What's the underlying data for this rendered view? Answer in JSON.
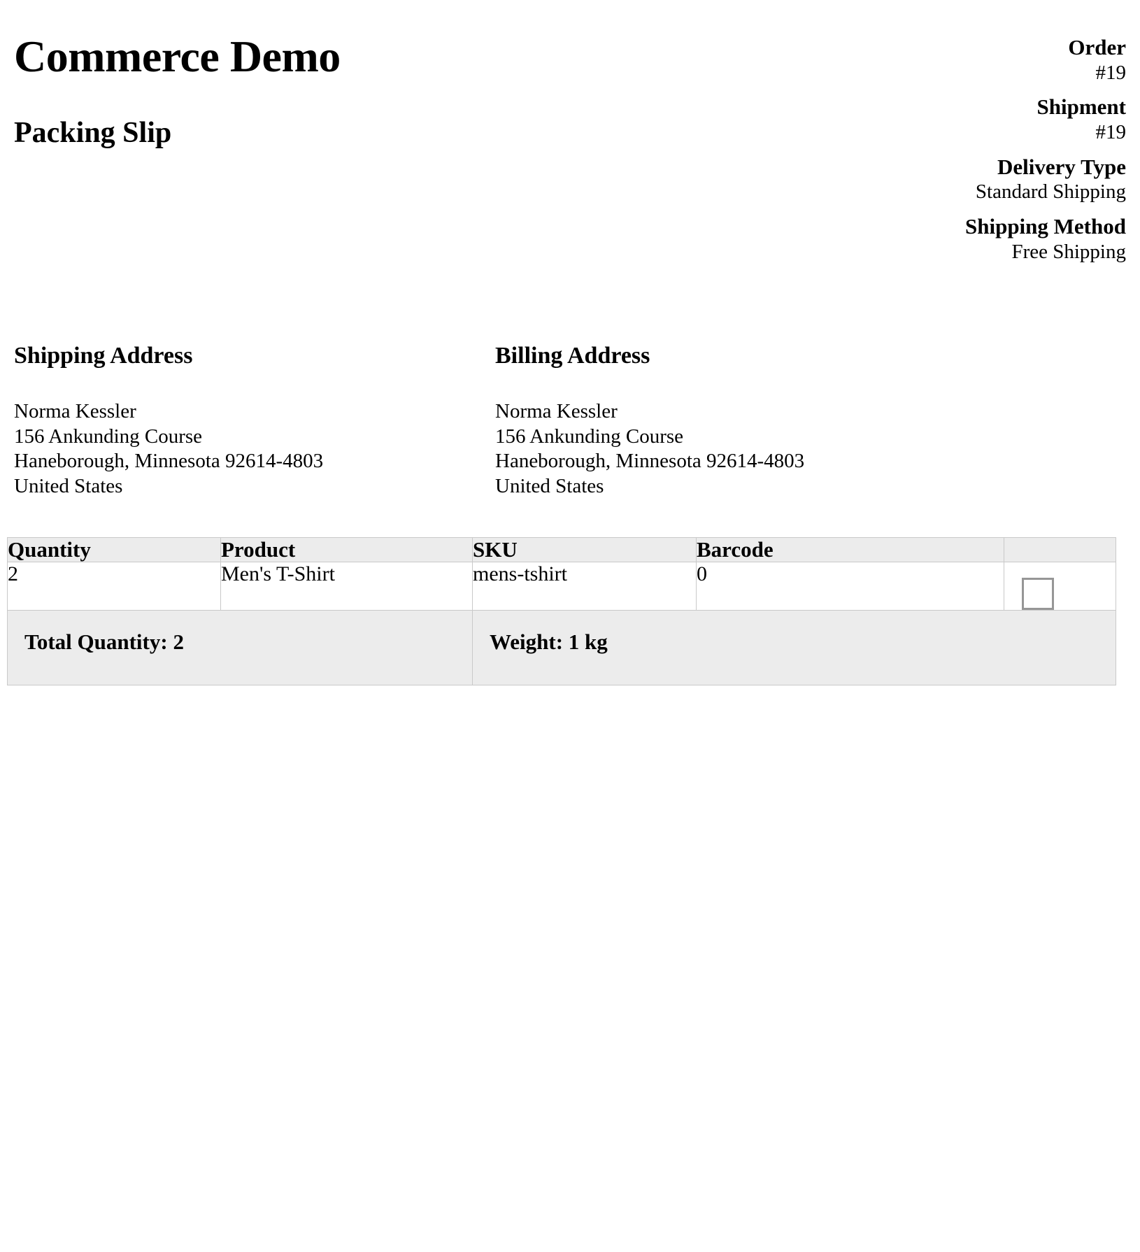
{
  "header": {
    "brand": "Commerce Demo",
    "document_title": "Packing Slip"
  },
  "meta": [
    {
      "label": "Order",
      "value": "#19"
    },
    {
      "label": "Shipment",
      "value": "#19"
    },
    {
      "label": "Delivery Type",
      "value": "Standard Shipping"
    },
    {
      "label": "Shipping Method",
      "value": "Free Shipping"
    }
  ],
  "shipping_address": {
    "heading": "Shipping Address",
    "lines": [
      "Norma Kessler",
      "156 Ankunding Course",
      "Haneborough, Minnesota 92614-4803",
      "United States"
    ]
  },
  "billing_address": {
    "heading": "Billing Address",
    "lines": [
      "Norma Kessler",
      "156 Ankunding Course",
      "Haneborough, Minnesota 92614-4803",
      "United States"
    ]
  },
  "items_table": {
    "columns": [
      "Quantity",
      "Product",
      "SKU",
      "Barcode",
      ""
    ],
    "rows": [
      {
        "quantity": "2",
        "product": "Men's T-Shirt",
        "sku": "mens-tshirt",
        "barcode": "0",
        "checkbox_checked": false
      }
    ],
    "footer": {
      "total_quantity": "Total Quantity: 2",
      "weight": "Weight: 1 kg"
    }
  },
  "colors": {
    "page_background": "#ffffff",
    "table_band": "#ececec",
    "table_border": "#c9c9c9",
    "checkbox_border": "#969696",
    "text": "#000000"
  }
}
